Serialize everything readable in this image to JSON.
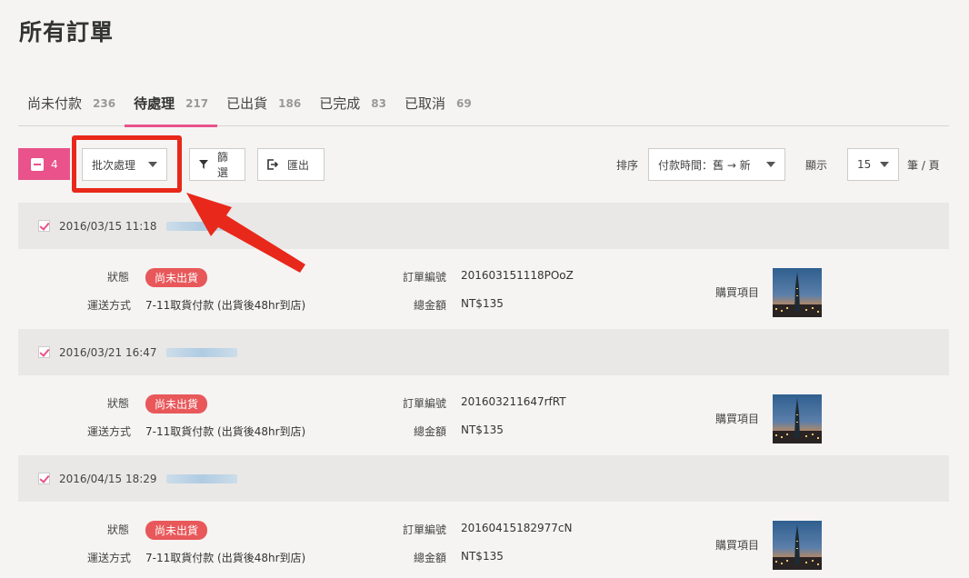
{
  "page_title": "所有訂單",
  "tabs": [
    {
      "label": "尚未付款",
      "count": "236"
    },
    {
      "label": "待處理",
      "count": "217"
    },
    {
      "label": "已出貨",
      "count": "186"
    },
    {
      "label": "已完成",
      "count": "83"
    },
    {
      "label": "已取消",
      "count": "69"
    }
  ],
  "toolbar": {
    "selected_count": "4",
    "batch_label": "批次處理",
    "filter_label": "篩選",
    "export_label": "匯出",
    "sort_label": "排序",
    "sort_value": "付款時間：舊 → 新",
    "show_label": "顯示",
    "per_page_value": "15",
    "per_page_unit": "筆 / 頁"
  },
  "labels": {
    "status": "狀態",
    "shipping": "運送方式",
    "order_no": "訂單編號",
    "total": "總金額",
    "items": "購買項目"
  },
  "orders": [
    {
      "date": "2016/03/15 11:18",
      "status": "尚未出貨",
      "shipping": "7-11取貨付款 (出貨後48hr到店)",
      "order_no": "201603151118POoZ",
      "total": "NT$135"
    },
    {
      "date": "2016/03/21 16:47",
      "status": "尚未出貨",
      "shipping": "7-11取貨付款 (出貨後48hr到店)",
      "order_no": "201603211647rfRT",
      "total": "NT$135"
    },
    {
      "date": "2016/04/15 18:29",
      "status": "尚未出貨",
      "shipping": "7-11取貨付款 (出貨後48hr到店)",
      "order_no": "20160415182977cN",
      "total": "NT$135"
    }
  ],
  "colors": {
    "accent": "#e9528a",
    "badge": "#e8585a",
    "annotation": "#e8281a"
  },
  "icons": [
    "minus-checkbox-icon",
    "caret-down-icon",
    "filter-icon",
    "export-icon",
    "checkbox-checked-icon",
    "product-thumbnail"
  ]
}
